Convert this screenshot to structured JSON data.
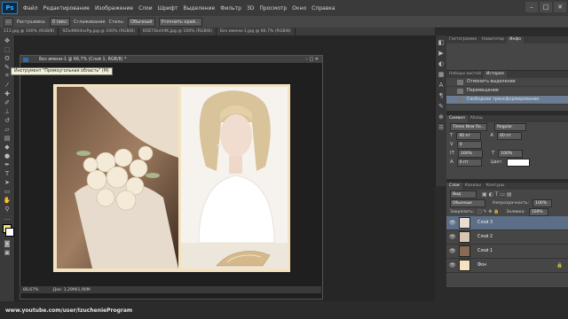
{
  "app": {
    "logo": "Ps"
  },
  "menu": [
    "Файл",
    "Редактирование",
    "Изображение",
    "Слои",
    "Шрифт",
    "Выделение",
    "Фильтр",
    "3D",
    "Просмотр",
    "Окно",
    "Справка"
  ],
  "window_controls": [
    "–",
    "□",
    "✕"
  ],
  "options": {
    "feather_label": "Растушевка:",
    "feather_value": "0 пикс",
    "antialias": "Сглаживание",
    "style_label": "Стиль:",
    "style_value": "Обычный",
    "refine": "Уточнить край..."
  },
  "doc_tabs": [
    "111.jpg @ 100% (RGB/8)",
    "9Zxd6Kt4ssPg.jpg @ 100% (RGB/8)",
    "6OET4zxV4K.jpg @ 100% (RGB/8)",
    "Без имени-1.jpg @ 66,7% (RGB/8)"
  ],
  "document": {
    "title": "Без имени-1 @ 66,7% (Слой 1, RGB/8) *",
    "tooltip": "Инструмент \"Прямоугольная область\" (M)",
    "zoom": "66,67%",
    "doc_size": "Док: 1,29M/1,90M"
  },
  "panels": {
    "top_tabs": [
      "Гистограмма",
      "Навигатор",
      "Инфо"
    ],
    "history_tabs": [
      "Наборы кистей",
      "История"
    ],
    "history_items": [
      "Отменить выделение",
      "Перемещение",
      "Свободное трансформирование"
    ],
    "char_tabs": [
      "Символ",
      "Абзац"
    ],
    "font_family": "Times New Ro...",
    "font_style": "Regular",
    "font_size": "90 пт",
    "leading": "60 пт",
    "tracking": "0",
    "scale_v": "100%",
    "scale_h": "100%",
    "baseline": "0 пт",
    "color_label": "Цвет:",
    "layers_tabs": [
      "Слои",
      "Каналы",
      "Контуры"
    ],
    "kind": "Вид",
    "blend_mode": "Обычные",
    "opacity_label": "Непрозрачность:",
    "opacity_value": "100%",
    "lock_label": "Закрепить:",
    "fill_label": "Заливка:",
    "fill_value": "100%",
    "layers": [
      "Слой 3",
      "Слой 2",
      "Слой 1",
      "Фон"
    ]
  },
  "watermark": "www.youtube.com/user/IzuchenieProgram",
  "colors": {
    "accent": "#5d6f88",
    "canvas": "#262626",
    "collage_bg": "#f4e3c0"
  }
}
